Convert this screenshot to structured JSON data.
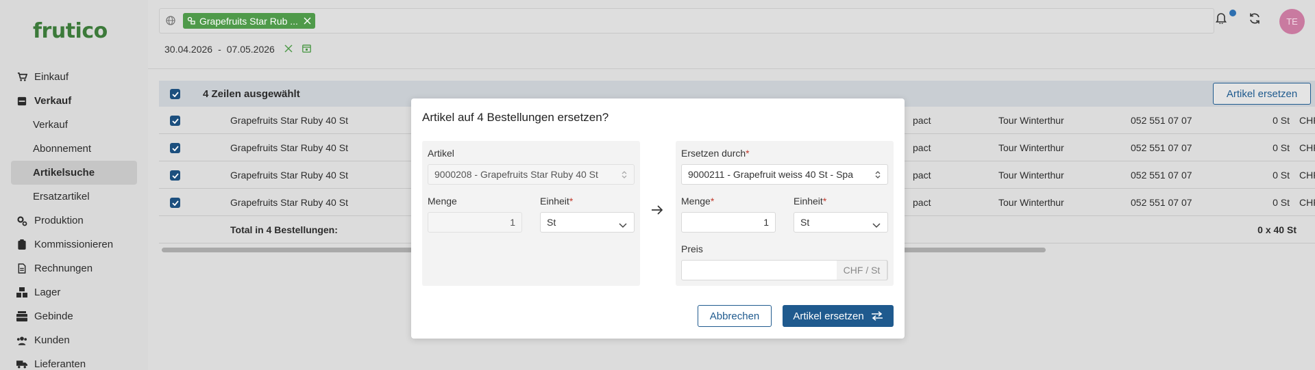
{
  "app": {
    "logo": "frutico"
  },
  "sidebar": {
    "items": [
      {
        "label": "Einkauf",
        "icon": "cart-icon"
      },
      {
        "label": "Verkauf",
        "icon": "inbox-icon"
      },
      {
        "label": "Verkauf"
      },
      {
        "label": "Abonnement"
      },
      {
        "label": "Artikelsuche"
      },
      {
        "label": "Ersatzartikel"
      },
      {
        "label": "Produktion",
        "icon": "gears-icon"
      },
      {
        "label": "Kommissionieren",
        "icon": "clipboard-icon"
      },
      {
        "label": "Rechnungen",
        "icon": "document-icon"
      },
      {
        "label": "Lager",
        "icon": "boxes-icon"
      },
      {
        "label": "Gebinde",
        "icon": "crate-icon"
      },
      {
        "label": "Kunden",
        "icon": "users-icon"
      },
      {
        "label": "Lieferanten",
        "icon": "truck-icon"
      }
    ]
  },
  "filter": {
    "chip_label": "Grapefruits Star Rub ...",
    "date_from": "30.04.2026",
    "date_sep": "-",
    "date_to": "07.05.2026"
  },
  "user": {
    "initials": "TE"
  },
  "table": {
    "selection_label": "4 Zeilen ausgewählt",
    "replace_button": "Artikel ersetzen",
    "rows": [
      {
        "name": "Grapefruits Star Ruby 40 St",
        "col": "pact",
        "tour": "Tour Winterthur",
        "phone": "052 551 07 07",
        "qty": "0 St",
        "cur": "CHF"
      },
      {
        "name": "Grapefruits Star Ruby 40 St",
        "col": "pact",
        "tour": "Tour Winterthur",
        "phone": "052 551 07 07",
        "qty": "0 St",
        "cur": "CHF"
      },
      {
        "name": "Grapefruits Star Ruby 40 St",
        "col": "pact",
        "tour": "Tour Winterthur",
        "phone": "052 551 07 07",
        "qty": "0 St",
        "cur": "CHF"
      },
      {
        "name": "Grapefruits Star Ruby 40 St",
        "col": "pact",
        "tour": "Tour Winterthur",
        "phone": "052 551 07 07",
        "qty": "0 St",
        "cur": "CHF"
      }
    ],
    "total_label": "Total in 4 Bestellungen:",
    "total_value": "0 x 40 St"
  },
  "modal": {
    "title": "Artikel auf 4 Bestellungen ersetzen?",
    "left": {
      "article_label": "Artikel",
      "article_value": "9000208 - Grapefruits Star Ruby 40 St",
      "qty_label": "Menge",
      "qty_value": "1",
      "unit_label": "Einheit",
      "unit_value": "St"
    },
    "right": {
      "replace_label": "Ersetzen durch",
      "replace_value": "9000211 - Grapefruit weiss 40 St - Spa",
      "qty_label": "Menge",
      "qty_value": "1",
      "unit_label": "Einheit",
      "unit_value": "St",
      "price_label": "Preis",
      "price_value": "",
      "price_unit": "CHF / St"
    },
    "required_mark": "*",
    "cancel_button": "Abbrechen",
    "confirm_button": "Artikel ersetzen"
  },
  "colors": {
    "primary": "#1f5a8e",
    "brand_green": "#3c7a3a",
    "chip_green": "#4f9a4a",
    "required": "#c0392b"
  }
}
